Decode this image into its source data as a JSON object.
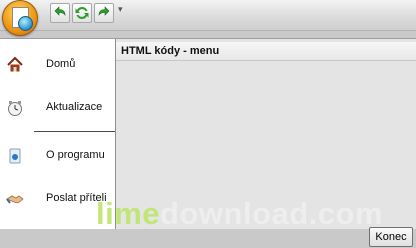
{
  "quick_access": {
    "buttons": [
      "undo-icon",
      "refresh-icon",
      "redo-icon"
    ]
  },
  "sidebar": {
    "items": [
      {
        "label": "Domů",
        "icon": "home-icon"
      },
      {
        "label": "Aktualizace",
        "icon": "clock-icon"
      },
      {
        "label": "O programu",
        "icon": "info-icon"
      },
      {
        "label": "Poslat příteli",
        "icon": "handshake-icon"
      }
    ]
  },
  "content": {
    "title": "HTML kódy - menu"
  },
  "footer": {
    "close_label": "Konec"
  },
  "watermark": {
    "part1": "lime",
    "part2": "download",
    "part3": ".",
    "part4": "com"
  },
  "colors": {
    "orb": "#f3a51f",
    "undo_arrow": "#2e9c2e",
    "watermark_accent": "#bee66e"
  }
}
